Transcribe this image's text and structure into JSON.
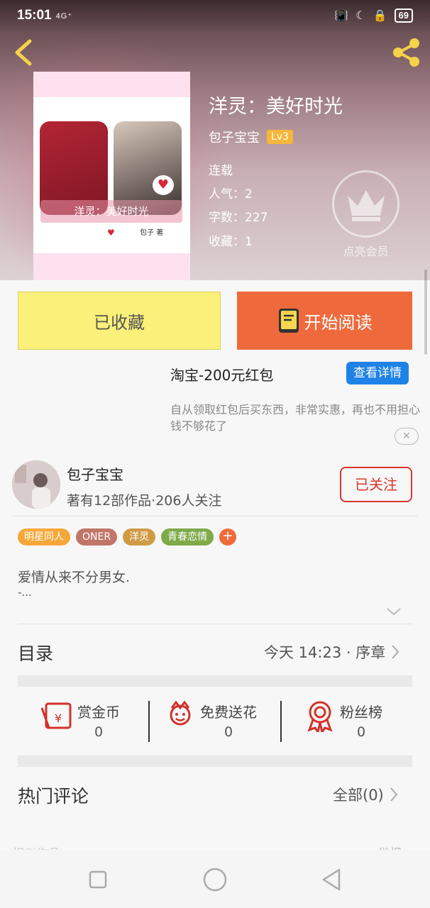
{
  "status_bar": {
    "time": "15:01",
    "network": "4G⁺",
    "battery": "69"
  },
  "book": {
    "title": "洋灵：美好时光",
    "author": "包子宝宝",
    "level": "Lv3",
    "status": "连载",
    "popularity": "人气：2",
    "word_count": "字数：227",
    "favorites": "收藏：1",
    "cover": {
      "title": "洋灵：美好时光",
      "author": "包子 著"
    }
  },
  "vip": {
    "label": "点亮会员"
  },
  "actions": {
    "collected": "已收藏",
    "start_reading": "开始阅读"
  },
  "ad": {
    "title": "淘宝-200元红包",
    "button": "查看详情",
    "description": "自从领取红包后买东西，非常实惠，再也不用担心钱不够花了"
  },
  "author_card": {
    "name": "包子宝宝",
    "stats": "著有12部作品·206人关注",
    "follow": "已关注"
  },
  "tags": [
    {
      "label": "明星同人",
      "color": "#f5a83a"
    },
    {
      "label": "ONER",
      "color": "#c1766a"
    },
    {
      "label": "洋灵",
      "color": "#cf9b46"
    },
    {
      "label": "青春恋情",
      "color": "#7faa4a"
    }
  ],
  "tag_add": "+",
  "description": {
    "line1": "爱情从来不分男女.",
    "line2": "-..."
  },
  "toc": {
    "label": "目录",
    "latest": "今天 14:23 · 序章"
  },
  "stats": {
    "reward": {
      "label": "赏金币",
      "value": "0"
    },
    "flowers": {
      "label": "免费送花",
      "value": "0"
    },
    "fans": {
      "label": "粉丝榜",
      "value": "0"
    }
  },
  "comments": {
    "label": "热门评论",
    "all": "全部(0)"
  },
  "colors": {
    "accent_orange": "#ee6a3c",
    "collected_yellow": "#faf07a",
    "follow_red": "#d9362b",
    "icon_red": "#d4312b",
    "ad_blue": "#1e82e6"
  }
}
